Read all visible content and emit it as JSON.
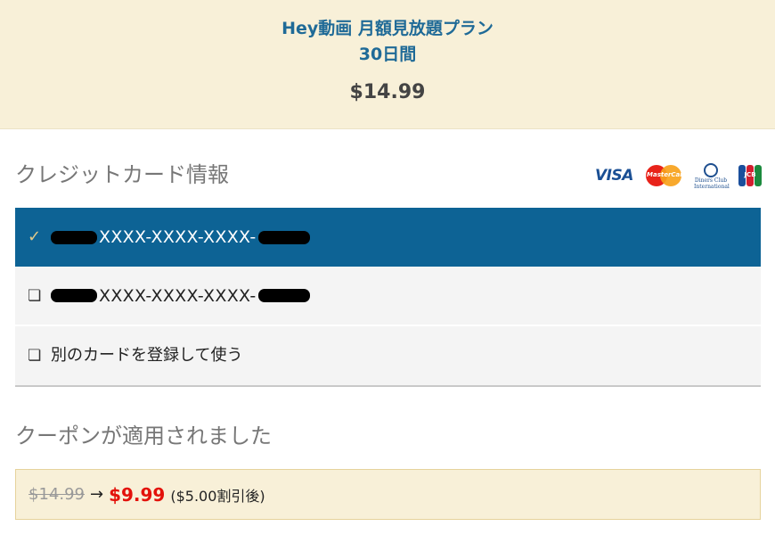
{
  "plan": {
    "title": "Hey動画 月額見放題プラン",
    "period": "30日間",
    "price": "$14.99"
  },
  "credit_card": {
    "heading": "クレジットカード情報",
    "brands": [
      {
        "name": "VISA",
        "icon": "visa-logo"
      },
      {
        "name": "MasterCard",
        "icon": "mastercard-logo"
      },
      {
        "name": "Diners Club International",
        "icon": "diners-club-logo"
      },
      {
        "name": "JCB",
        "icon": "jcb-logo"
      }
    ],
    "options": [
      {
        "number_masked": "XXXX-XXXX-XXXX-",
        "selected": true,
        "icon": "check-icon"
      },
      {
        "number_masked": "XXXX-XXXX-XXXX-",
        "selected": false,
        "icon": "checkbox-icon"
      },
      {
        "label": "別のカードを登録して使う",
        "selected": false,
        "icon": "checkbox-icon"
      }
    ]
  },
  "coupon": {
    "heading": "クーポンが適用されました",
    "old_price": "$14.99",
    "arrow": "→",
    "new_price": "$9.99",
    "discount_note": "($5.00割引後)"
  },
  "colors": {
    "header_bg": "#f8f0d8",
    "accent_blue": "#0d6395",
    "title_blue": "#1f6a97",
    "sale_red": "#e3120b"
  }
}
